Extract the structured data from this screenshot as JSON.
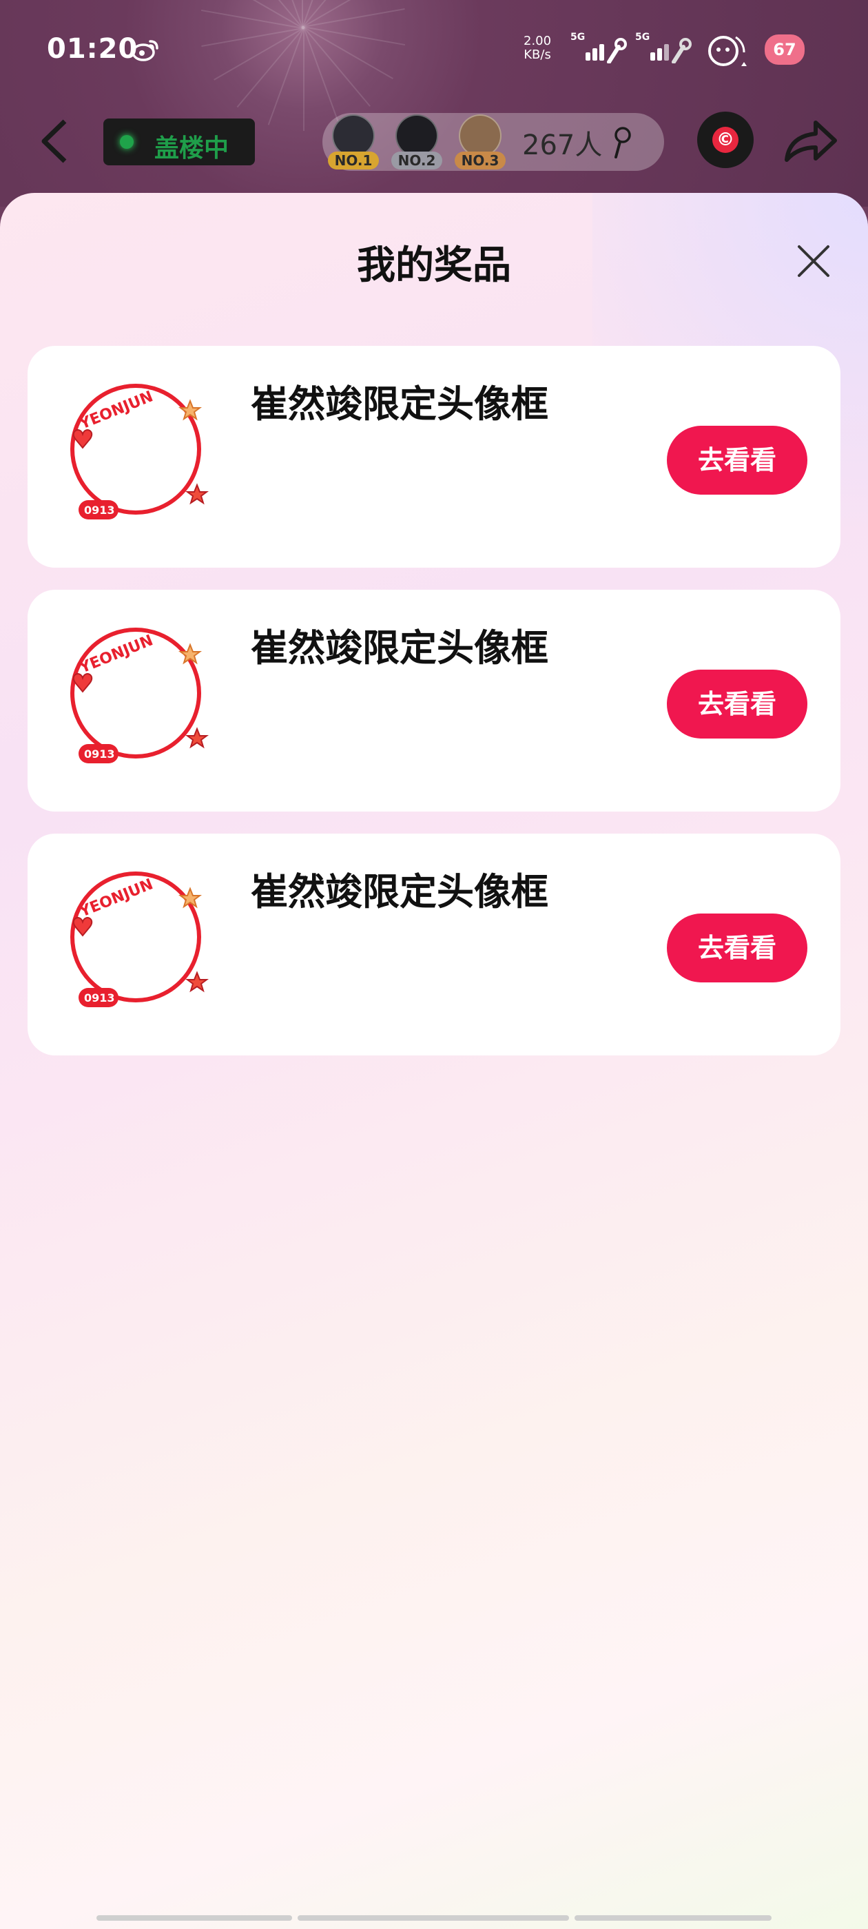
{
  "status_bar": {
    "time": "01:20",
    "net_speed_value": "2.00",
    "net_speed_unit": "KB/s",
    "sim1_label": "5G",
    "sim2_label": "5G",
    "battery": "67"
  },
  "top_bar": {
    "live_status": "盖楼中",
    "rank_badges": [
      "NO.1",
      "NO.2",
      "NO.3"
    ],
    "participants": "267人"
  },
  "sheet": {
    "title": "我的奖品",
    "prizes": [
      {
        "name": "崔然竣限定头像框",
        "button": "去看看"
      },
      {
        "name": "崔然竣限定头像框",
        "button": "去看看"
      },
      {
        "name": "崔然竣限定头像框",
        "button": "去看看"
      }
    ]
  },
  "frame_art": {
    "top_text": "YEONJUN",
    "tag_text": "0913"
  },
  "colors": {
    "accent": "#f0174f",
    "live_green": "#1f9e4a",
    "rank_gold": "#d8a530",
    "rank_silver": "#9a9aa4",
    "rank_bronze": "#c98a48"
  }
}
